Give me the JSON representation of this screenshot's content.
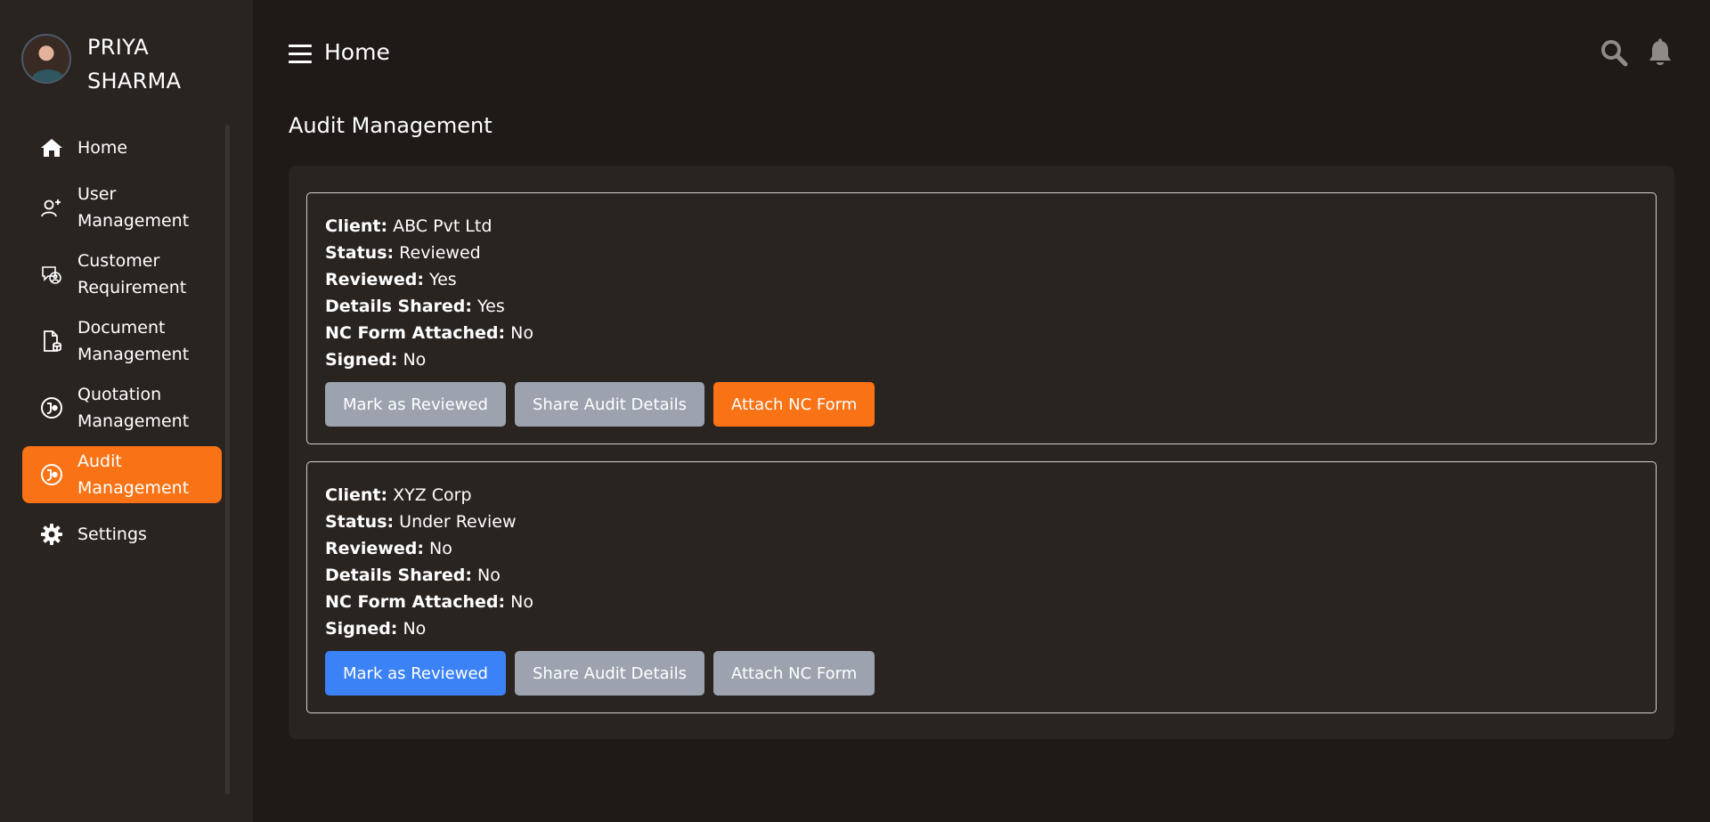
{
  "user": {
    "name": "PRIYA SHARMA"
  },
  "sidebar": {
    "items": [
      {
        "label": "Home",
        "icon": "home-icon",
        "active": false
      },
      {
        "label": "User Management",
        "icon": "add-user-icon",
        "active": false
      },
      {
        "label": "Customer Requirement",
        "icon": "chat-user-icon",
        "active": false
      },
      {
        "label": "Document Management",
        "icon": "document-icon",
        "active": false
      },
      {
        "label": "Quotation Management",
        "icon": "quotation-icon",
        "active": false
      },
      {
        "label": "Audit Management",
        "icon": "audit-icon",
        "active": true
      },
      {
        "label": "Settings",
        "icon": "gear-icon",
        "active": false
      }
    ]
  },
  "header": {
    "title": "Home"
  },
  "page": {
    "title": "Audit Management"
  },
  "labels": {
    "client": "Client:",
    "status": "Status:",
    "reviewed": "Reviewed:",
    "details_shared": "Details Shared:",
    "nc_form_attached": "NC Form Attached:",
    "signed": "Signed:"
  },
  "audits": [
    {
      "client": "ABC Pvt Ltd",
      "status": "Reviewed",
      "reviewed": "Yes",
      "details_shared": "Yes",
      "nc_form_attached": "No",
      "signed": "No",
      "buttons": {
        "mark_reviewed": "Mark as Reviewed",
        "share_details": "Share Audit Details",
        "attach_nc": "Attach NC Form"
      }
    },
    {
      "client": "XYZ Corp",
      "status": "Under Review",
      "reviewed": "No",
      "details_shared": "No",
      "nc_form_attached": "No",
      "signed": "No",
      "buttons": {
        "mark_reviewed": "Mark as Reviewed",
        "share_details": "Share Audit Details",
        "attach_nc": "Attach NC Form"
      }
    }
  ],
  "colors": {
    "accent": "#f97316",
    "primary": "#3b82f6",
    "disabled": "#9ca3af",
    "sidebar_bg": "#2a2421",
    "page_bg": "#1f1a17"
  }
}
